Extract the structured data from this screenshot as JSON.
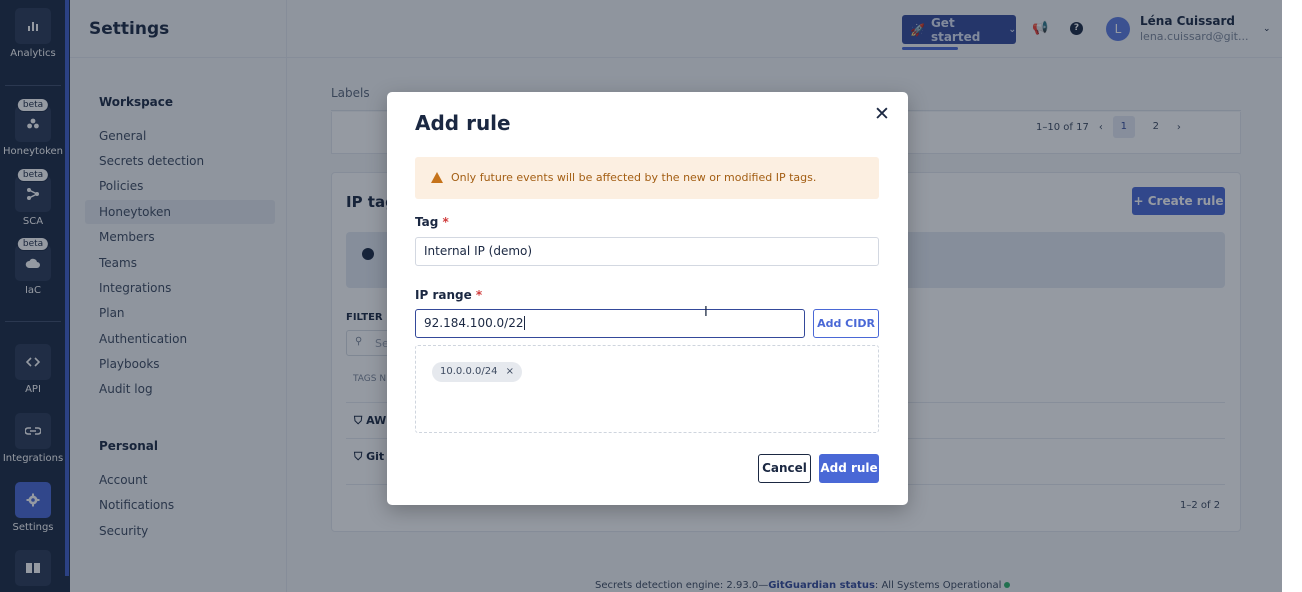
{
  "header": {
    "title": "Settings",
    "get_started": "Get started",
    "user_initial": "L",
    "user_name": "Léna Cuissard",
    "user_email": "lena.cuissard@git..."
  },
  "rail": {
    "items": [
      {
        "label": "Analytics",
        "icon": "bar-chart-icon"
      },
      {
        "label": "Honeytoken",
        "badge": "beta",
        "icon": "honeytoken-icon"
      },
      {
        "label": "SCA",
        "badge": "beta",
        "icon": "sca-icon"
      },
      {
        "label": "IaC",
        "badge": "beta",
        "icon": "cloud-icon"
      },
      {
        "label": "API",
        "icon": "code-icon"
      },
      {
        "label": "Integrations",
        "icon": "integration-icon"
      },
      {
        "label": "Settings",
        "icon": "gear-icon"
      },
      {
        "label": "",
        "icon": "book-icon"
      }
    ]
  },
  "sidebar": {
    "workspace_heading": "Workspace",
    "workspace_items": [
      "General",
      "Secrets detection",
      "Policies",
      "Honeytoken",
      "Members",
      "Teams",
      "Integrations",
      "Plan",
      "Authentication",
      "Playbooks",
      "Audit log"
    ],
    "personal_heading": "Personal",
    "personal_items": [
      "Account",
      "Notifications",
      "Security"
    ]
  },
  "content": {
    "tab_labels": "Labels",
    "pager_text": "1–10 of 17",
    "pager_pages": [
      "1",
      "2"
    ],
    "section_title": "IP tag",
    "create_rule": "+ Create rule",
    "filter_label": "FILTER",
    "search_stub": "Se",
    "column_stub": "TAGS N",
    "row1": "AW",
    "row2": "Git",
    "count2": "1–2 of 2"
  },
  "footer": {
    "engine": "Secrets detection engine: 2.93.0—",
    "status_link": "GitGuardian status",
    "status_text": ": All Systems Operational"
  },
  "modal": {
    "title": "Add rule",
    "warning": "Only future events will be affected by the new or modified IP tags.",
    "tag_label": "Tag",
    "tag_value": "Internal IP (demo)",
    "range_label": "IP range",
    "range_value": "92.184.100.0/22",
    "add_cidr": "Add CIDR",
    "chip": "10.0.0.0/24",
    "cancel": "Cancel",
    "submit": "Add rule"
  },
  "colors": {
    "rail_bg": "#1b2842",
    "accent": "#4a68d6",
    "warning_bg": "#fcefe1"
  }
}
